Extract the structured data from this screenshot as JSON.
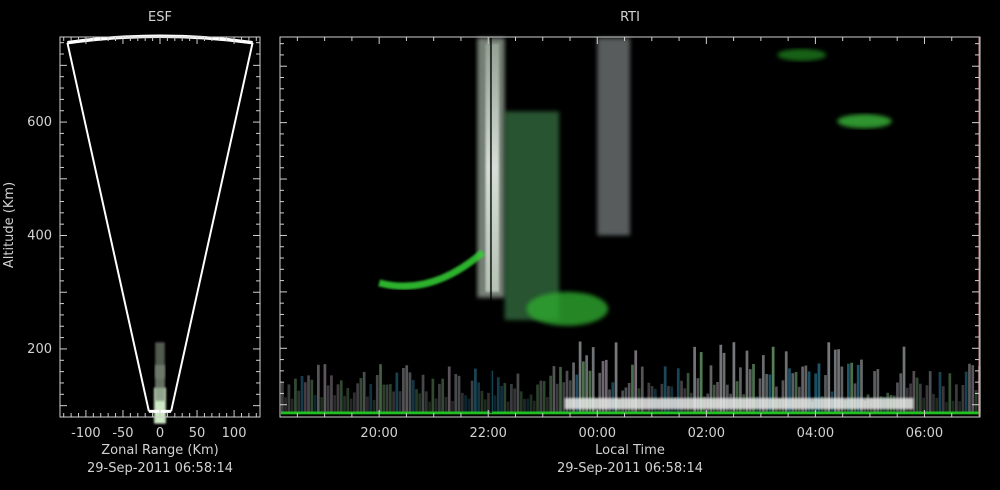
{
  "colors": {
    "background": "#000000",
    "axis": "#d0d0d0",
    "text": "#d2d2d2",
    "fan": "#ffffff"
  },
  "chart_data": [
    {
      "type": "scatter",
      "title": "ESF",
      "xlabel": "Zonal Range (Km)",
      "ylabel": "Altitude (Km)",
      "timestamp": "29-Sep-2011 06:58:14",
      "xlim": [
        -135,
        135
      ],
      "ylim": [
        80,
        750
      ],
      "x_tick_values": [
        -100,
        -50,
        0,
        50,
        100
      ],
      "x_tick_labels": [
        "-100",
        "-50",
        "0",
        "50",
        "100"
      ],
      "y_tick_values": [
        200,
        400,
        600
      ],
      "y_tick_labels": [
        "200",
        "400",
        "600"
      ],
      "fan_beam": {
        "altitude_bottom_km": 90,
        "altitude_top_km": 745,
        "left_edge_top_km": -125,
        "right_edge_top_km": 125,
        "left_edge_bottom_km": -15,
        "right_edge_bottom_km": 15
      },
      "echoes": [
        {
          "x": 0,
          "y": 100,
          "intensity": 0.95
        },
        {
          "x": 0,
          "y": 140,
          "intensity": 0.5
        },
        {
          "x": 0,
          "y": 180,
          "intensity": 0.4
        }
      ]
    },
    {
      "type": "heatmap",
      "title": "RTI",
      "xlabel": "Local Time",
      "ylabel": "",
      "timestamp": "29-Sep-2011 06:58:14",
      "xlim": [
        18.2,
        31.0
      ],
      "ylim": [
        80,
        750
      ],
      "x_tick_values": [
        20,
        22,
        24,
        26,
        28,
        30
      ],
      "x_tick_labels": [
        "20:00",
        "22:00",
        "00:00",
        "02:00",
        "04:00",
        "06:00"
      ],
      "y_tick_values": [
        200,
        400,
        600
      ],
      "features": [
        {
          "kind": "plume",
          "time_start": 21.8,
          "time_end": 22.3,
          "alt_low": 290,
          "alt_high": 750,
          "color": "#d8e8d8"
        },
        {
          "kind": "plume",
          "time_start": 22.3,
          "time_end": 23.3,
          "alt_low": 250,
          "alt_high": 620,
          "color": "#4a9a5a"
        },
        {
          "kind": "plume",
          "time_start": 24.0,
          "time_end": 24.6,
          "alt_low": 400,
          "alt_high": 750,
          "color": "#a0a8a8"
        },
        {
          "kind": "layer",
          "time_start": 20.0,
          "time_end": 21.9,
          "alt_low": 300,
          "alt_high": 325,
          "color": "#36d236"
        },
        {
          "kind": "blob",
          "time_start": 22.7,
          "time_end": 24.2,
          "alt_low": 240,
          "alt_high": 300,
          "color": "#2ea82e"
        },
        {
          "kind": "blob",
          "time_start": 28.4,
          "time_end": 29.4,
          "alt_low": 590,
          "alt_high": 615,
          "color": "#3ab83a"
        },
        {
          "kind": "blob",
          "time_start": 27.3,
          "time_end": 28.2,
          "alt_low": 710,
          "alt_high": 730,
          "color": "#1e7a1e"
        },
        {
          "kind": "bottom_layer",
          "time_start": 18.2,
          "time_end": 31.0,
          "alt_low": 85,
          "alt_high": 200,
          "color": "#b8bcc0"
        },
        {
          "kind": "baseline",
          "time_start": 18.2,
          "time_end": 31.0,
          "alt_low": 83,
          "alt_high": 88,
          "color": "#22c822"
        }
      ]
    }
  ]
}
